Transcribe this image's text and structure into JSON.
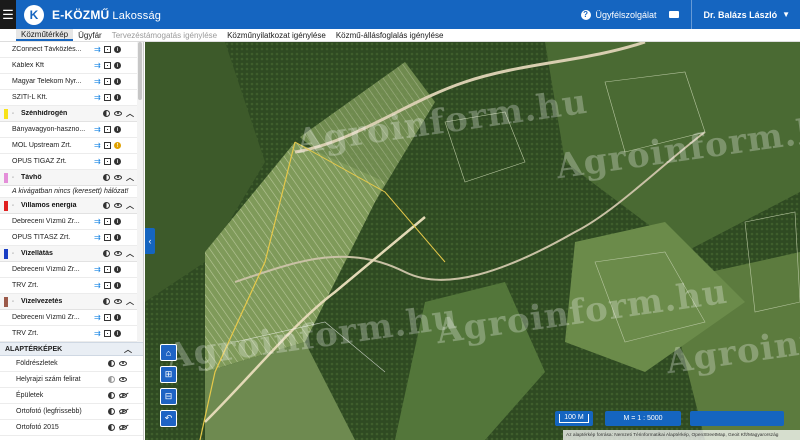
{
  "app": {
    "logo_letter": "K",
    "title": "E-KÖZMŰ",
    "subtitle": "Lakosság",
    "help_label": "Ügyfélszolgálat",
    "user_name": "Dr. Balázs László"
  },
  "tabs": [
    {
      "label": "Közműtérkép",
      "state": "active"
    },
    {
      "label": "Ügyfár",
      "state": "normal"
    },
    {
      "label": "Tervezéstámogatás igénylése",
      "state": "disabled"
    },
    {
      "label": "Közműnyilatkozat igénylése",
      "state": "normal"
    },
    {
      "label": "Közmű-állásfoglalás igénylése",
      "state": "normal"
    }
  ],
  "layers": {
    "top_rows": [
      "ZConnect Távközlés...",
      "Káblex Kft",
      "Magyar Telekom Nyr...",
      "SZITI-L Kft."
    ],
    "groups": [
      {
        "name": "Szénhidrogén",
        "color": "#f7e21a",
        "rows": [
          "Bányavagyon-haszno...",
          "MOL Upstream Zrt.",
          "OPUS TIGÁZ Zrt."
        ],
        "warn_row": 1
      },
      {
        "name": "Távhő",
        "color": "#e48fd9",
        "notice": "A kivágatban nincs (keresett) hálózat!",
        "rows": []
      },
      {
        "name": "Villamos energia",
        "color": "#e02020",
        "rows": [
          "Debreceni Vízmű Zr...",
          "OPUS TITÁSZ Zrt."
        ]
      },
      {
        "name": "Vízellátás",
        "color": "#1a3ec4",
        "rows": [
          "Debreceni Vízmű Zr...",
          "TRV Zrt."
        ]
      },
      {
        "name": "Vízelvezetés",
        "color": "#9c5a4a",
        "rows": [
          "Debreceni Vízmű Zr...",
          "TRV Zrt."
        ]
      }
    ]
  },
  "base_maps": {
    "title": "ALAPTÉRKÉPEK",
    "items": [
      "Földrészletek",
      "Helyrajzi szám felirat",
      "Épületek",
      "Ortofotó (legfrissebb)",
      "Ortofotó 2015"
    ]
  },
  "map": {
    "scale_bar": "100 M",
    "scale_ratio": "M = 1 : 5000",
    "attribution": "Az alaptérkép forrása: Nemzeti Térinformatikai Alaptérkép, OpenStreetMap, Geoit Kft/Magyarország",
    "watermark": "Agroinform.hu"
  }
}
